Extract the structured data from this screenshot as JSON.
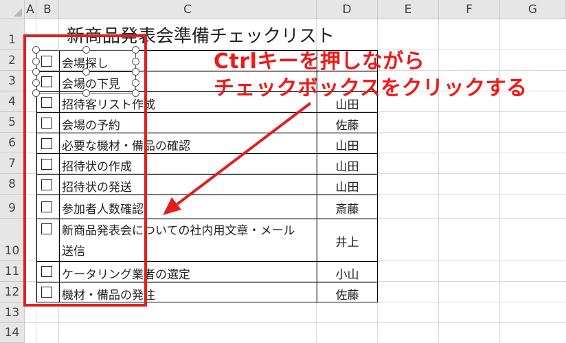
{
  "columns": [
    "A",
    "B",
    "C",
    "D",
    "E",
    "F",
    "G"
  ],
  "rows": [
    "1",
    "2",
    "3",
    "4",
    "5",
    "6",
    "7",
    "8",
    "9",
    "10",
    "11",
    "12",
    "13",
    "14"
  ],
  "sheet_title": "新商品発表会準備チェックリスト",
  "tasks": [
    {
      "task": "会場探し",
      "person": ""
    },
    {
      "task": "会場の下見",
      "person": ""
    },
    {
      "task": "招待客リスト作成",
      "person": "山田"
    },
    {
      "task": "会場の予約",
      "person": "佐藤"
    },
    {
      "task": "必要な機材・備品の確認",
      "person": "山田"
    },
    {
      "task": "招待状の作成",
      "person": "山田"
    },
    {
      "task": "招待状の発送",
      "person": "山田"
    },
    {
      "task": "参加者人数確認",
      "person": "斎藤"
    },
    {
      "task": "新商品発表会についての社内用文章・メール",
      "task_line2": "送信",
      "person": "井上"
    },
    {
      "task": "ケータリング業者の選定",
      "person": "小山"
    },
    {
      "task": "機材・備品の発注",
      "person": "佐藤"
    }
  ],
  "callout": {
    "line1": "Ctrlキーを押しながら",
    "line2": "チェックボックスをクリックする"
  },
  "colors": {
    "accent_red": "#e11f1f",
    "header_gray": "#e6e6e6"
  }
}
